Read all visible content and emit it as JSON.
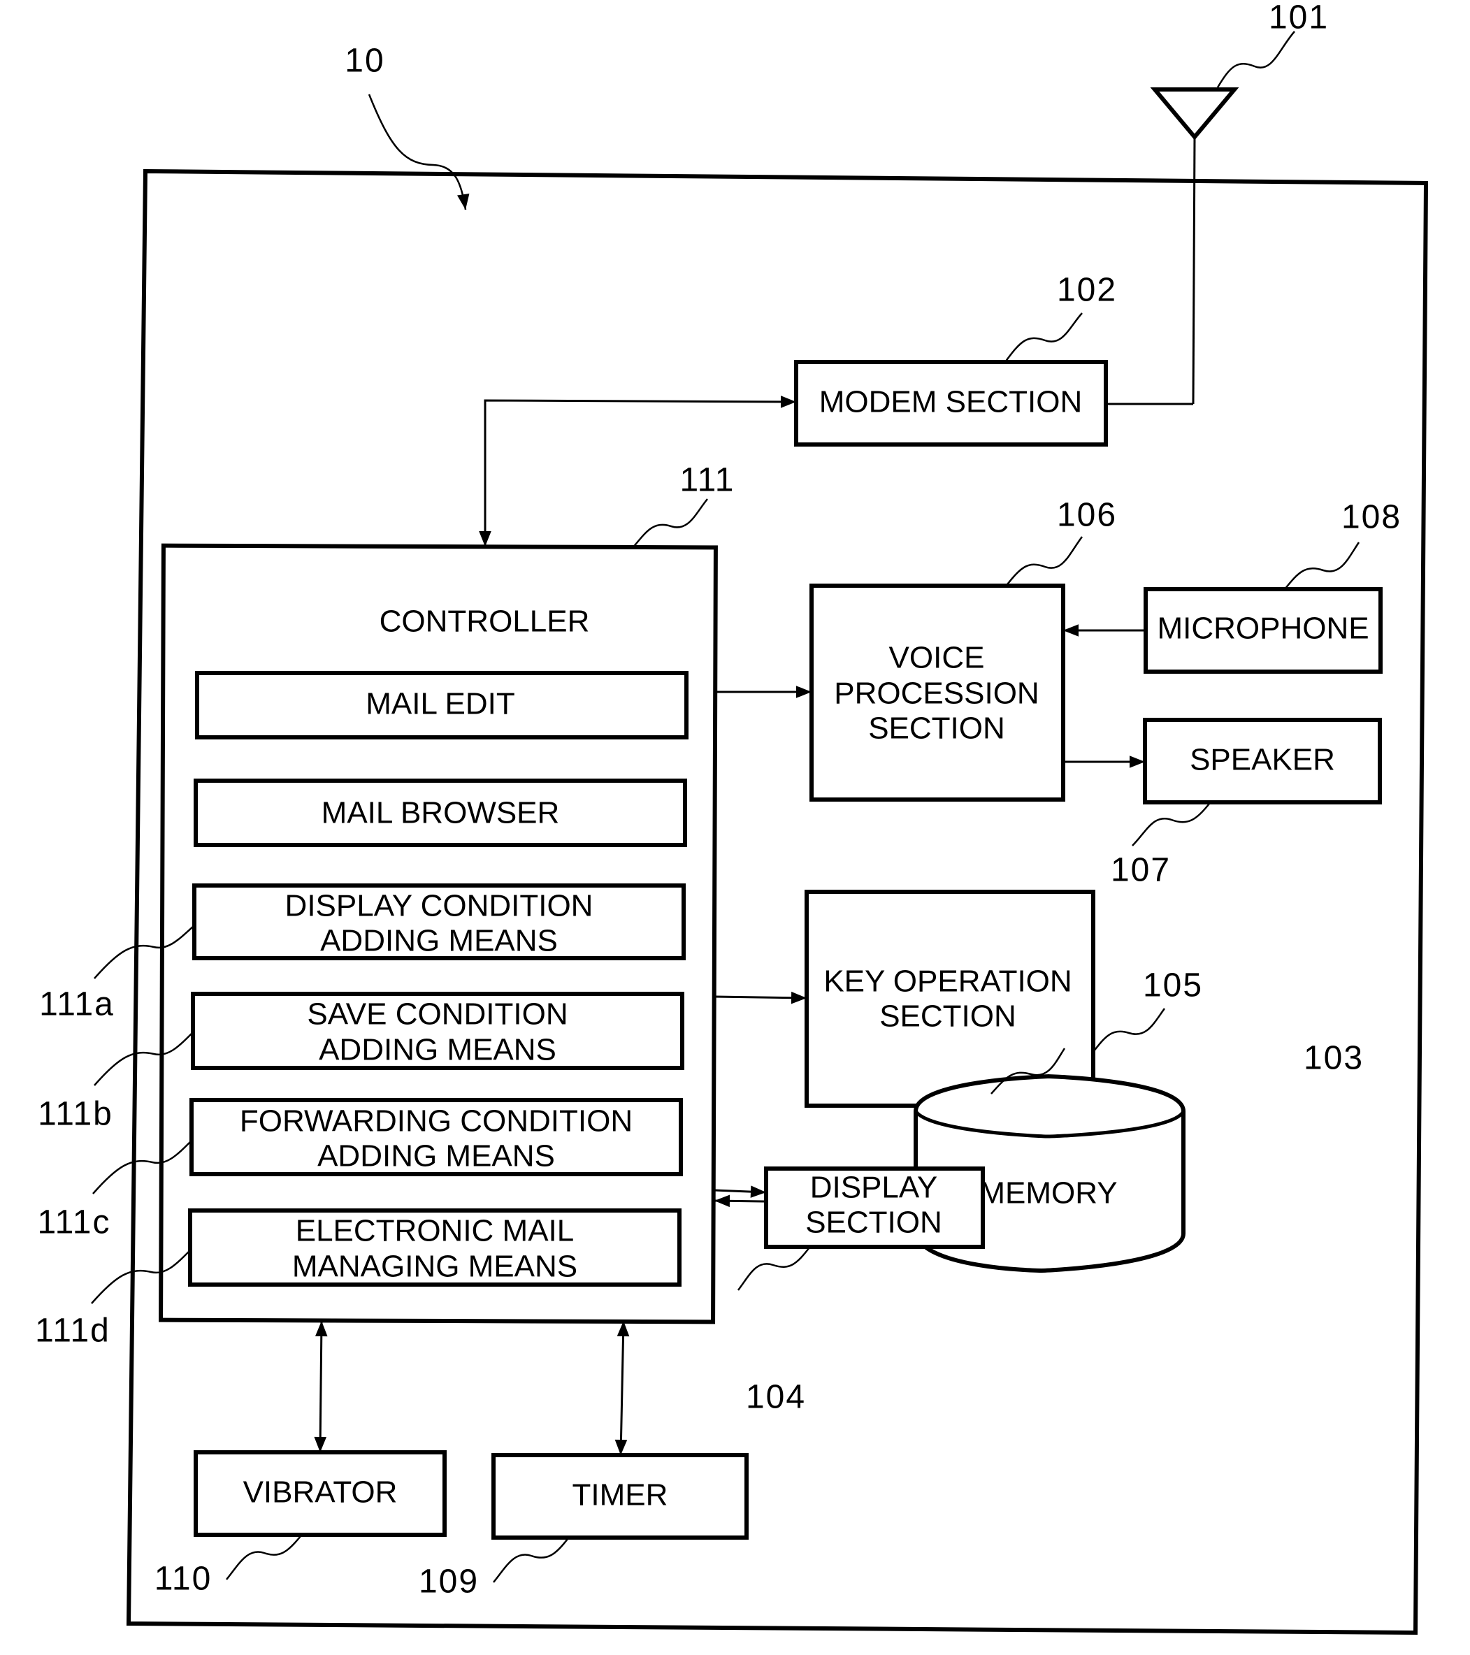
{
  "figure": {
    "device_ref": "10",
    "antenna_ref": "101",
    "blocks": {
      "modem": {
        "ref": "102",
        "lines": [
          "MODEM SECTION"
        ]
      },
      "memory": {
        "ref": "103",
        "lines": [
          "MEMORY"
        ]
      },
      "display": {
        "ref": "104",
        "lines": [
          "DISPLAY",
          "SECTION"
        ]
      },
      "key_operation": {
        "ref": "105",
        "lines": [
          "KEY OPERATION",
          "SECTION"
        ]
      },
      "voice_processing": {
        "ref": "106",
        "lines": [
          "VOICE",
          "PROCESSION",
          "SECTION"
        ]
      },
      "speaker": {
        "ref": "107",
        "lines": [
          "SPEAKER"
        ]
      },
      "microphone": {
        "ref": "108",
        "lines": [
          "MICROPHONE"
        ]
      },
      "timer": {
        "ref": "109",
        "lines": [
          "TIMER"
        ]
      },
      "vibrator": {
        "ref": "110",
        "lines": [
          "VIBRATOR"
        ]
      },
      "controller": {
        "ref": "111",
        "lines": [
          "CONTROLLER"
        ]
      }
    },
    "controller_modules": [
      {
        "ref": "",
        "lines": [
          "MAIL EDIT"
        ]
      },
      {
        "ref": "",
        "lines": [
          "MAIL BROWSER"
        ]
      },
      {
        "ref": "111a",
        "lines": [
          "DISPLAY CONDITION",
          "ADDING MEANS"
        ]
      },
      {
        "ref": "111b",
        "lines": [
          "SAVE CONDITION",
          "ADDING MEANS"
        ]
      },
      {
        "ref": "111c",
        "lines": [
          "FORWARDING CONDITION",
          "ADDING MEANS"
        ]
      },
      {
        "ref": "111d",
        "lines": [
          "ELECTRONIC MAIL",
          "MANAGING MEANS"
        ]
      }
    ]
  }
}
